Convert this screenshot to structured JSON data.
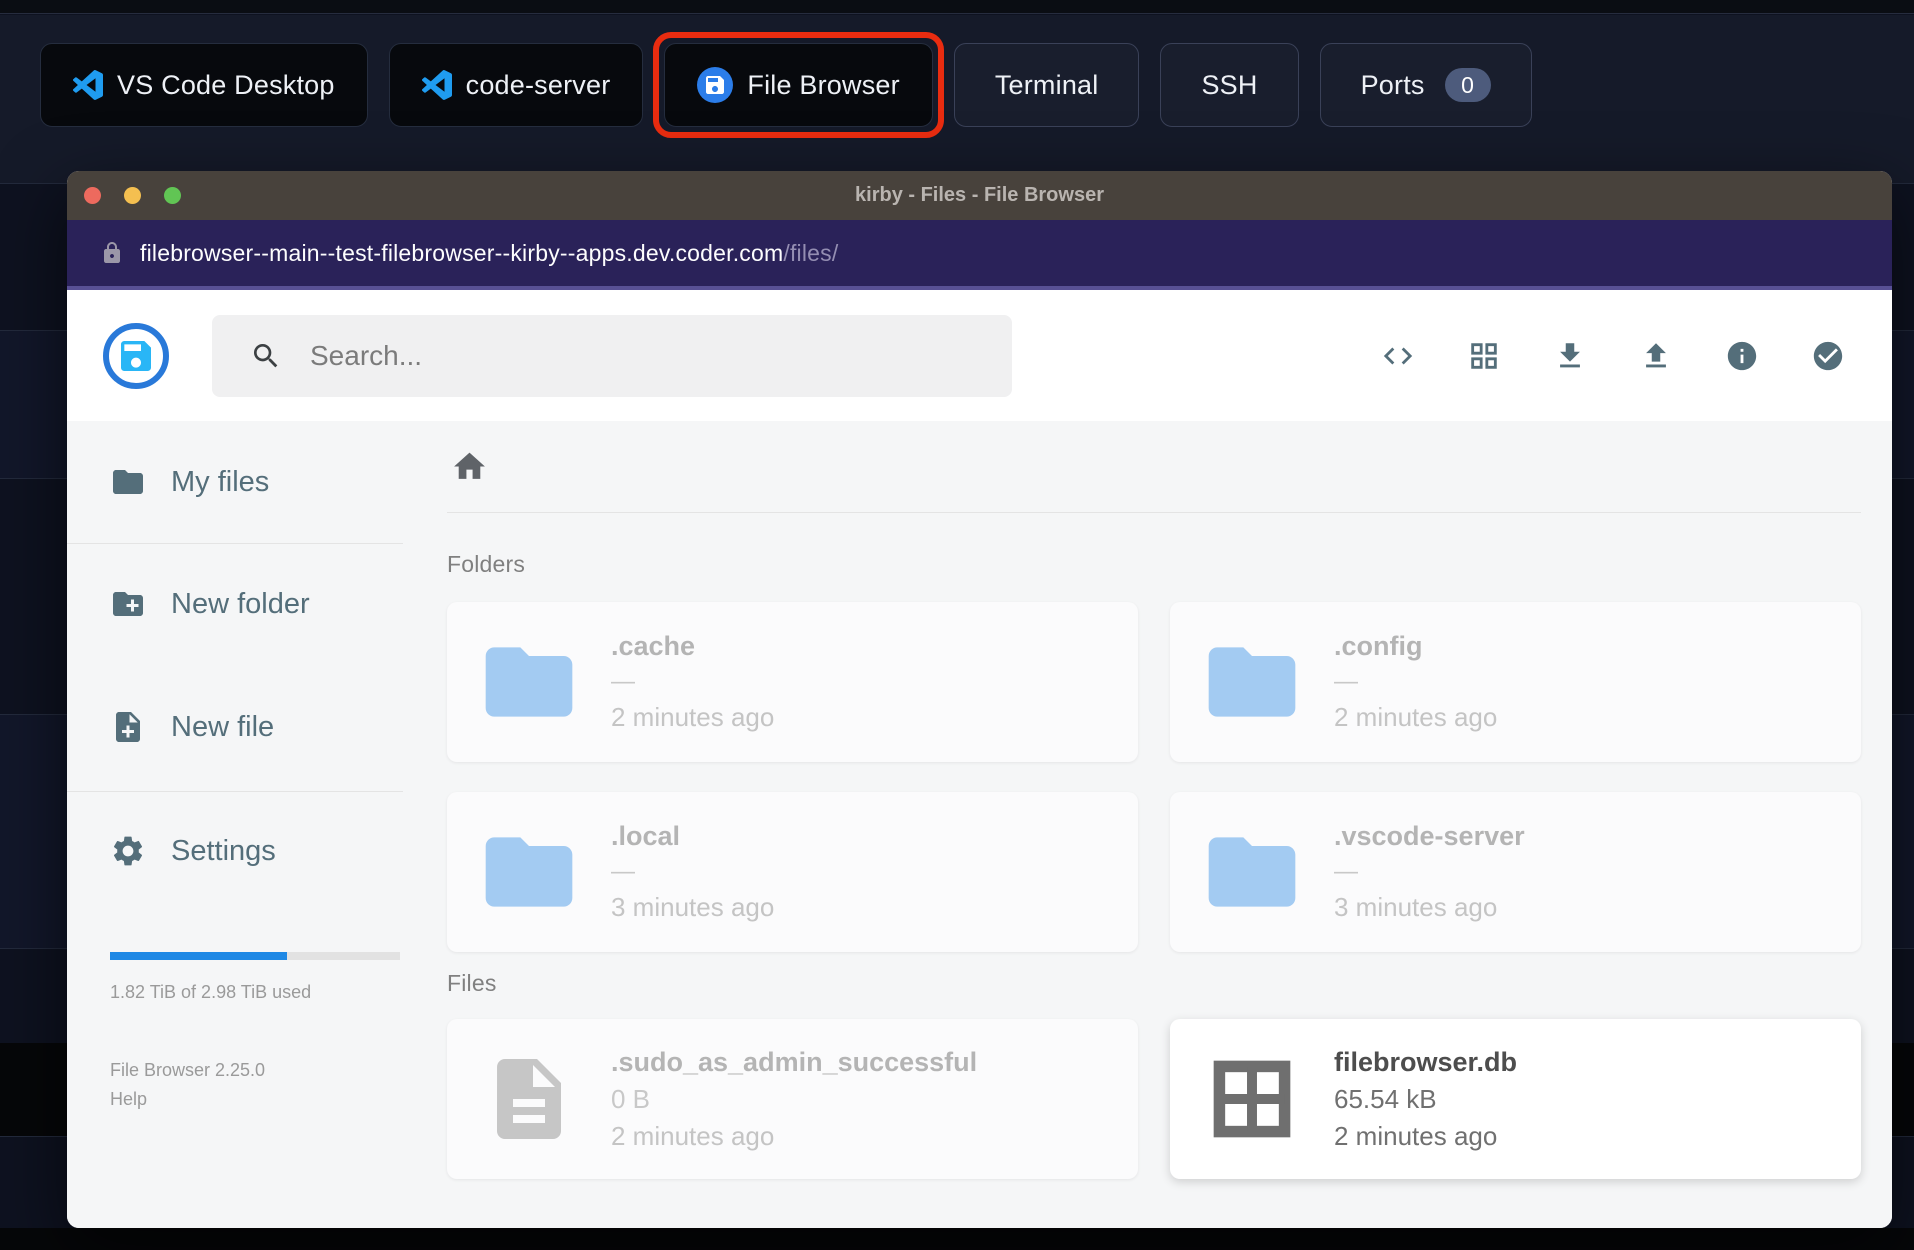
{
  "taskbar": {
    "apps": [
      {
        "label": "VS Code Desktop",
        "icon": "vscode"
      },
      {
        "label": "code-server",
        "icon": "vscode"
      },
      {
        "label": "File Browser",
        "icon": "filebrowser",
        "highlighted": true
      },
      {
        "label": "Terminal"
      },
      {
        "label": "SSH"
      },
      {
        "label": "Ports",
        "badge": "0"
      }
    ]
  },
  "window": {
    "title": "kirby - Files - File Browser",
    "url": {
      "domain": "filebrowser--main--test-filebrowser--kirby--apps.dev.coder.com",
      "path": "/files/"
    }
  },
  "header": {
    "search_placeholder": "Search...",
    "icons": [
      "code",
      "grid-view",
      "download",
      "upload",
      "info",
      "check-circle"
    ]
  },
  "sidebar": {
    "items": [
      {
        "label": "My files",
        "icon": "folder"
      },
      {
        "label": "New folder",
        "icon": "create-new-folder"
      },
      {
        "label": "New file",
        "icon": "note-add"
      },
      {
        "label": "Settings",
        "icon": "settings"
      }
    ],
    "storage": {
      "used_percent": 61,
      "label": "1.82 TiB of 2.98 TiB used"
    },
    "version": "File Browser 2.25.0",
    "help": "Help"
  },
  "main": {
    "sections": [
      {
        "heading": "Folders",
        "items": [
          {
            "name": ".cache",
            "size": "—",
            "time": "2 minutes ago",
            "icon": "folder",
            "muted": true
          },
          {
            "name": ".config",
            "size": "—",
            "time": "2 minutes ago",
            "icon": "folder",
            "muted": true
          },
          {
            "name": ".local",
            "size": "—",
            "time": "3 minutes ago",
            "icon": "folder",
            "muted": true
          },
          {
            "name": ".vscode-server",
            "size": "—",
            "time": "3 minutes ago",
            "icon": "folder",
            "muted": true
          }
        ]
      },
      {
        "heading": "Files",
        "items": [
          {
            "name": ".sudo_as_admin_successful",
            "size": "0 B",
            "time": "2 minutes ago",
            "icon": "document",
            "muted": true
          },
          {
            "name": "filebrowser.db",
            "size": "65.54 kB",
            "time": "2 minutes ago",
            "icon": "grid",
            "muted": false
          }
        ]
      }
    ]
  },
  "colors": {
    "highlight_ring": "#e92c10",
    "logo_ring_blue": "#2979d9",
    "taskbar_icon_blue": "#1f9cf0",
    "progress_blue": "#1e88e5",
    "folder_icon_blue": "#a3cbf2",
    "icon_slate": "#546e7a",
    "titlebar_brown": "#48423c",
    "urlbar_purple": "#2a2259",
    "ports_badge": "#4d5b7c",
    "traffic_red": "#ed6a5e",
    "traffic_yellow": "#f4bf50",
    "traffic_green": "#61c554"
  }
}
